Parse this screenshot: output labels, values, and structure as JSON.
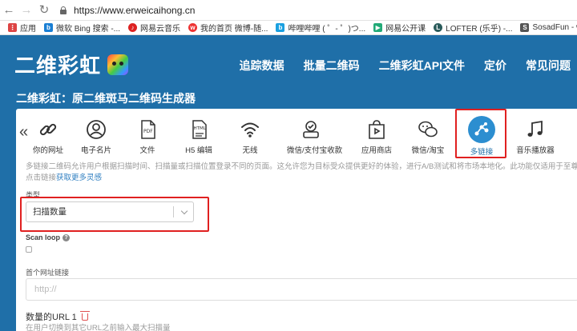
{
  "browser": {
    "url": "https://www.erweicaihong.cn",
    "bookmarks": [
      {
        "label": "应用",
        "icon": "apps-grid-icon",
        "color": "#d44"
      },
      {
        "label": "微软 Bing 搜索 -...",
        "icon": "bing-icon",
        "color": "#1a7fd4"
      },
      {
        "label": "网易云音乐",
        "icon": "netease-music-icon",
        "color": "#d22"
      },
      {
        "label": "我的首页 微博-随...",
        "icon": "weibo-icon",
        "color": "#e33"
      },
      {
        "label": "哔哩哔哩 ( ゜- ゜)つ...",
        "icon": "bilibili-icon",
        "color": "#1aa0e0"
      },
      {
        "label": "网易公开课",
        "icon": "netease-open-course-icon",
        "color": "#2a7"
      },
      {
        "label": "LOFTER (乐乎) -...",
        "icon": "lofter-icon",
        "color": "#2a5b5b"
      },
      {
        "label": "SosadFun - write f...",
        "icon": "sosadfun-icon",
        "color": "#555"
      }
    ]
  },
  "site": {
    "logo": "二维彩虹",
    "nav": [
      "追踪数据",
      "批量二维码",
      "二维彩虹API文件",
      "定价",
      "常见问题"
    ],
    "page_title": "二维彩虹：原二维斑马二维码生成器"
  },
  "types": [
    {
      "label": "你的网址",
      "icon": "link-icon"
    },
    {
      "label": "电子名片",
      "icon": "contact-card-icon"
    },
    {
      "label": "文件",
      "icon": "pdf-file-icon"
    },
    {
      "label": "H5 编辑",
      "icon": "html-file-icon"
    },
    {
      "label": "无线",
      "icon": "wifi-icon"
    },
    {
      "label": "微信/支付宝收款",
      "icon": "payment-icon"
    },
    {
      "label": "应用商店",
      "icon": "app-store-icon"
    },
    {
      "label": "微信/淘宝",
      "icon": "wechat-icon"
    },
    {
      "label": "多链接",
      "icon": "multi-link-icon",
      "active": true
    },
    {
      "label": "音乐播放器",
      "icon": "music-note-icon"
    }
  ],
  "form": {
    "description": "多链接二维码允许用户根据扫描时间、扫描量或扫描位置登录不同的页面。这允许您为目标受众提供更好的体验，进行A/B测试和将市场本地化。此功能仅适用于至尊版!",
    "description_link_prefix": "点击链接",
    "description_link": "获取更多灵感",
    "type_label": "类型",
    "type_value": "扫描数量",
    "scan_loop_label": "Scan loop",
    "first_url_label": "首个网址链接",
    "first_url_placeholder": "http://",
    "url1_title": "数量的URL 1",
    "url1_hint": "在用户切换到其它URL之前输入最大扫描量"
  },
  "colors": {
    "brand": "#1f6fa8",
    "accent": "#2c8ed0",
    "highlight": "#e02020"
  }
}
